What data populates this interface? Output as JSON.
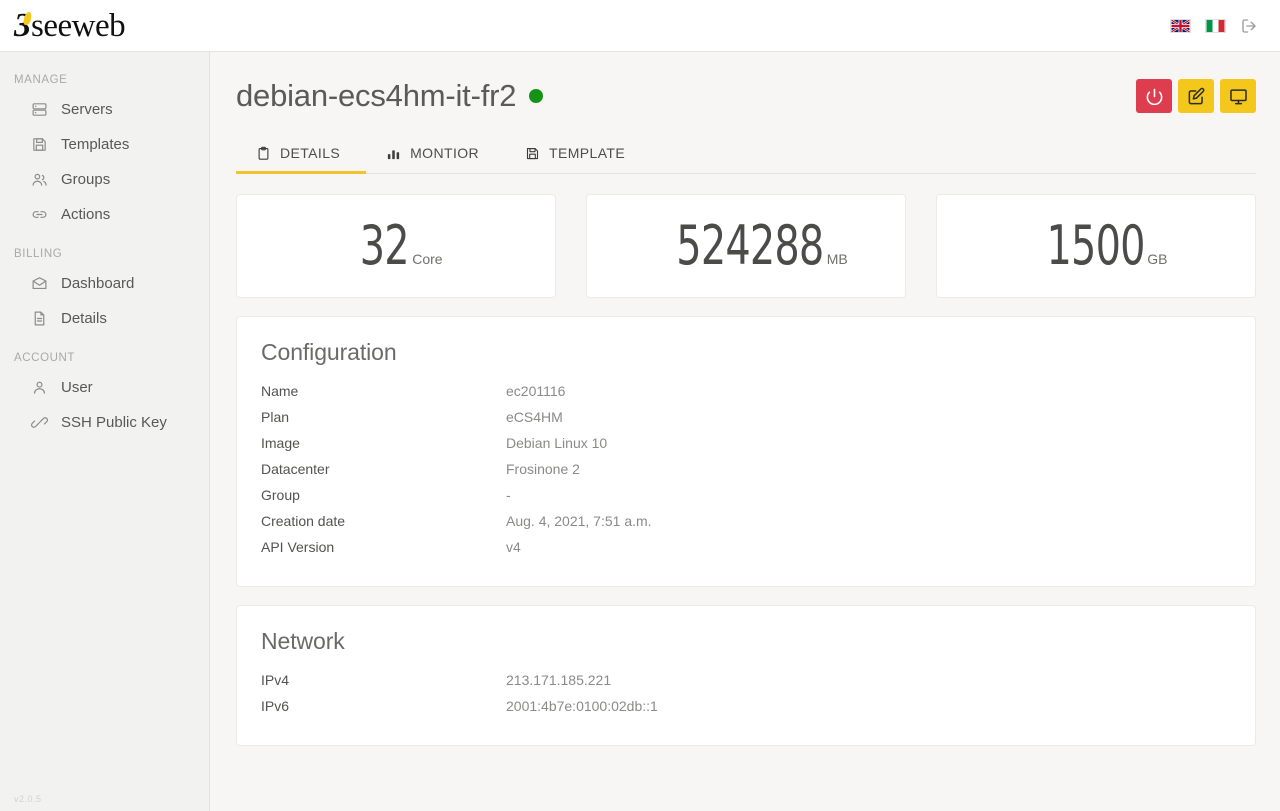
{
  "topbar": {
    "logo_mark": "3",
    "logo_text": "seeweb",
    "lang_en": "english-flag",
    "lang_it": "italian-flag",
    "logout": "logout-icon"
  },
  "sidebar": {
    "version": "v2.0.5",
    "sections": [
      {
        "title": "MANAGE",
        "items": [
          {
            "label": "Servers",
            "icon": "servers-icon"
          },
          {
            "label": "Templates",
            "icon": "templates-icon"
          },
          {
            "label": "Groups",
            "icon": "groups-icon"
          },
          {
            "label": "Actions",
            "icon": "actions-icon"
          }
        ]
      },
      {
        "title": "BILLING",
        "items": [
          {
            "label": "Dashboard",
            "icon": "dashboard-icon"
          },
          {
            "label": "Details",
            "icon": "details-icon"
          }
        ]
      },
      {
        "title": "ACCOUNT",
        "items": [
          {
            "label": "User",
            "icon": "user-icon"
          },
          {
            "label": "SSH Public Key",
            "icon": "key-icon"
          }
        ]
      }
    ]
  },
  "page": {
    "title": "debian-ecs4hm-it-fr2",
    "status": "running",
    "status_color": "#149414",
    "actions": [
      {
        "name": "power-button",
        "icon": "power-icon",
        "color": "#dd3d4f"
      },
      {
        "name": "edit-button",
        "icon": "edit-icon",
        "color": "#f3c71b"
      },
      {
        "name": "console-button",
        "icon": "console-icon",
        "color": "#f3c71b"
      }
    ]
  },
  "tabs": [
    {
      "label": "DETAILS",
      "icon": "clipboard-icon",
      "active": true
    },
    {
      "label": "MONTIOR",
      "icon": "bar-chart-icon",
      "active": false
    },
    {
      "label": "TEMPLATE",
      "icon": "floppy-icon",
      "active": false
    }
  ],
  "stats": [
    {
      "value": "32",
      "unit": "Core"
    },
    {
      "value": "524288",
      "unit": "MB"
    },
    {
      "value": "1500",
      "unit": "GB"
    }
  ],
  "configuration": {
    "title": "Configuration",
    "rows": [
      {
        "key": "Name",
        "value": "ec201116"
      },
      {
        "key": "Plan",
        "value": "eCS4HM"
      },
      {
        "key": "Image",
        "value": "Debian Linux 10"
      },
      {
        "key": "Datacenter",
        "value": "Frosinone 2"
      },
      {
        "key": "Group",
        "value": "-"
      },
      {
        "key": "Creation date",
        "value": "Aug. 4, 2021, 7:51 a.m."
      },
      {
        "key": "API Version",
        "value": "v4"
      }
    ]
  },
  "network": {
    "title": "Network",
    "rows": [
      {
        "key": "IPv4",
        "value": "213.171.185.221"
      },
      {
        "key": "IPv6",
        "value": "2001:4b7e:0100:02db::1"
      }
    ]
  }
}
